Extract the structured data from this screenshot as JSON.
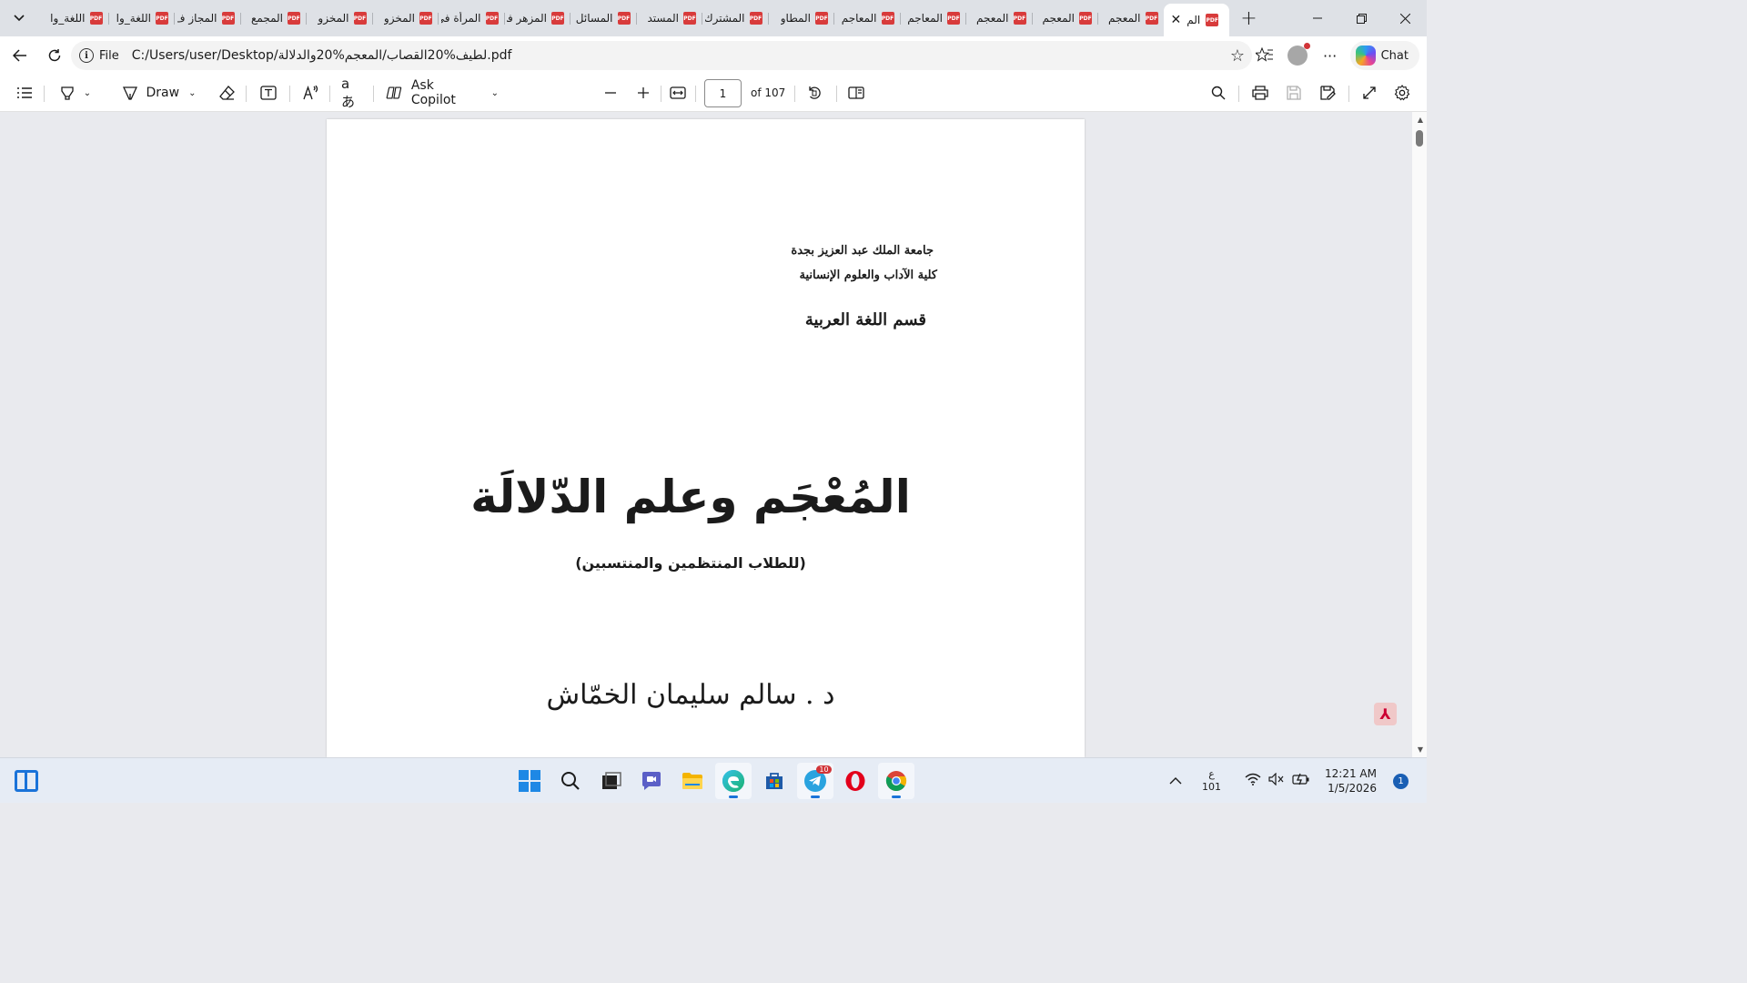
{
  "tabs": [
    {
      "label": "اللغة_وا"
    },
    {
      "label": "اللغة_وا"
    },
    {
      "label": "المجاز ف"
    },
    {
      "label": "المجمع"
    },
    {
      "label": "المخزو"
    },
    {
      "label": "المخزو"
    },
    {
      "label": "المرأة في"
    },
    {
      "label": "المزهر في"
    },
    {
      "label": "المسائل"
    },
    {
      "label": "المستد"
    },
    {
      "label": "المشترك"
    },
    {
      "label": "المطاو"
    },
    {
      "label": "المعاجم"
    },
    {
      "label": "المعاجم"
    },
    {
      "label": "المعجم"
    },
    {
      "label": "المعجم"
    },
    {
      "label": "المعجم"
    }
  ],
  "active_tab": {
    "label": "الم"
  },
  "pdf_icon_text": "PDF",
  "address": {
    "file_label": "File",
    "url": "C:/Users/user/Desktop/لطيف%20القصاب/المعجم%20والدلالة.pdf"
  },
  "chat_label": "Chat",
  "pdf_toolbar": {
    "draw_label": "Draw",
    "copilot_label": "Ask Copilot",
    "page_number": "1",
    "page_total": "of 107"
  },
  "document": {
    "university": "جامعة الملك عبد العزيز بجدة",
    "faculty": "كلية الآداب والعلوم الإنسانية",
    "department": "قسم اللغة العربية",
    "title": "المُعْجَم وعلم الدّلالَة",
    "subtitle": "(للطلاب المنتظمين والمنتسبين)",
    "author": "د . سالم سليمان الخمّاش"
  },
  "taskbar": {
    "telegram_badge": "10",
    "lang_top": "ع",
    "lang_bottom": "101",
    "time": "12:21 AM",
    "date": "1/5/2026",
    "notifications": "1"
  },
  "colors": {
    "accent": "#1a73d9",
    "pdf_red": "#d83b3b"
  }
}
